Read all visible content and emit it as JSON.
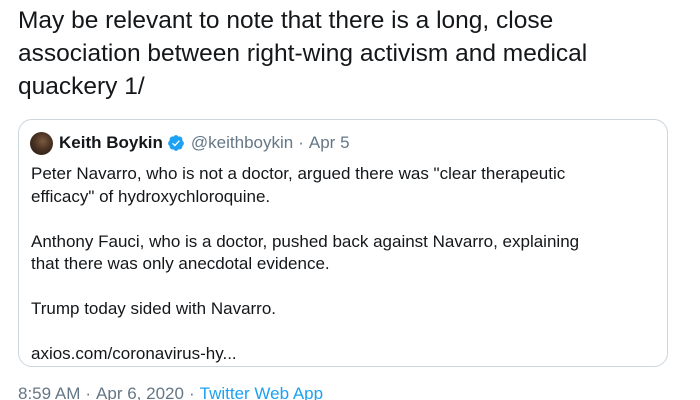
{
  "tweet": {
    "text": "May be relevant to note that there is a long, close\nassociation between right-wing activism and medical\nquackery 1/"
  },
  "quote": {
    "author_name": "Keith Boykin",
    "handle": "@keithboykin",
    "separator": "·",
    "date": "Apr 5",
    "paragraphs": [
      "Peter Navarro, who is not a doctor, argued there was \"clear therapeutic\nefficacy\" of hydroxychloroquine.",
      "Anthony Fauci, who is a doctor, pushed back against Navarro, explaining\nthat there was only anecdotal evidence.",
      "Trump today sided with Navarro.",
      "axios.com/coronavirus-hy..."
    ]
  },
  "meta": {
    "time": "8:59 AM",
    "separator": "·",
    "date": "Apr 6, 2020",
    "source": "Twitter Web App"
  },
  "colors": {
    "text": "#14171a",
    "secondary": "#657786",
    "accent": "#1da1f2",
    "border": "#ccd6dd"
  },
  "icons": {
    "verified": "verified-badge-icon",
    "avatar": "profile-photo"
  }
}
